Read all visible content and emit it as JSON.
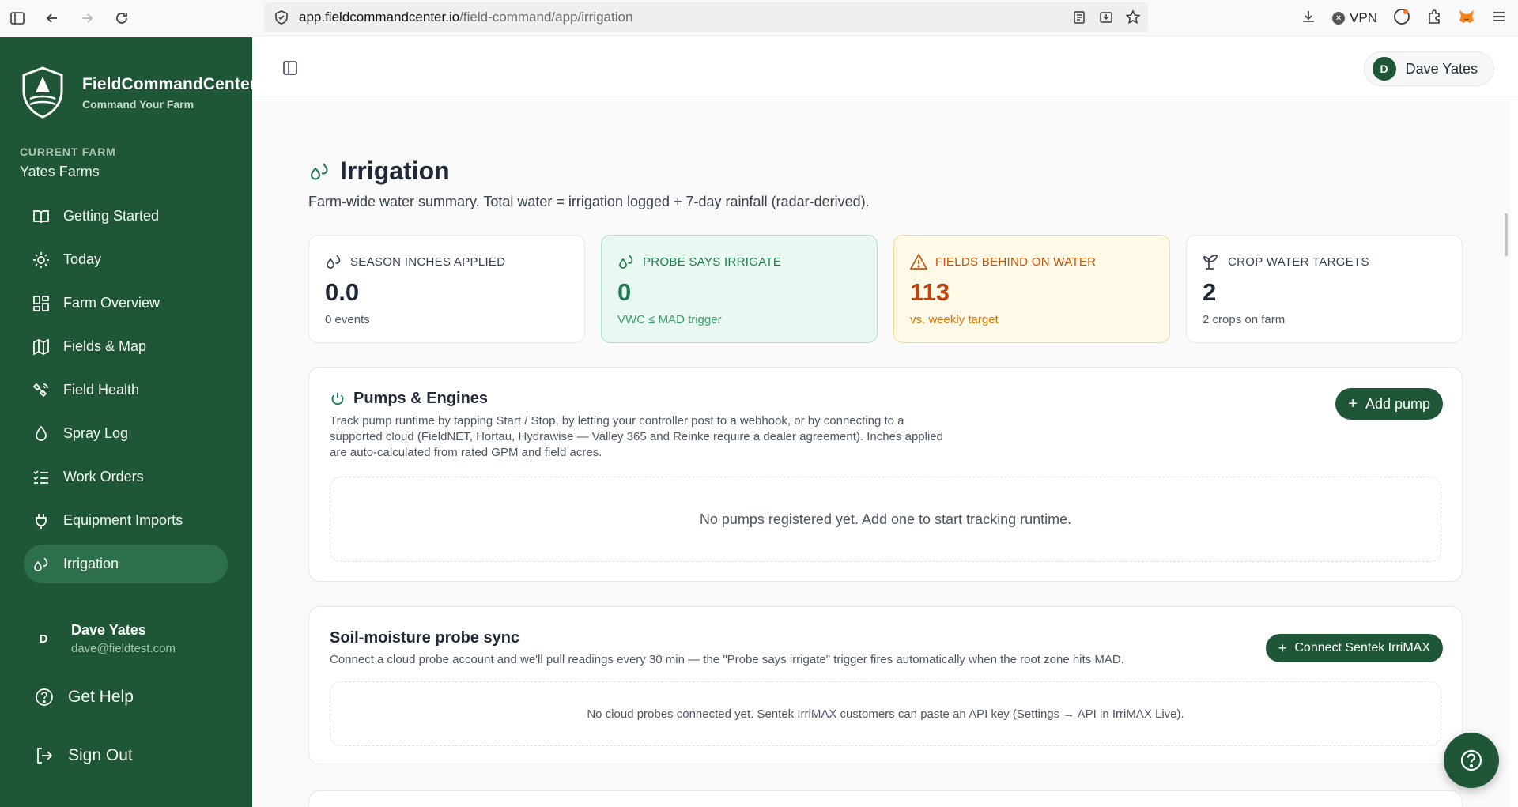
{
  "browser": {
    "url_host": "app.fieldcommandcenter.io",
    "url_path": "/field-command/app/irrigation",
    "vpn_label": "VPN"
  },
  "sidebar": {
    "brand_name": "FieldCommandCenter",
    "brand_tag": "Command Your Farm",
    "farm_label": "CURRENT FARM",
    "farm_name": "Yates Farms",
    "items": [
      {
        "label": "Getting Started",
        "icon": "book-icon"
      },
      {
        "label": "Today",
        "icon": "sun-icon"
      },
      {
        "label": "Farm Overview",
        "icon": "grid-icon"
      },
      {
        "label": "Fields & Map",
        "icon": "map-icon"
      },
      {
        "label": "Field Health",
        "icon": "satellite-icon"
      },
      {
        "label": "Spray Log",
        "icon": "droplet-icon"
      },
      {
        "label": "Work Orders",
        "icon": "list-checks-icon"
      },
      {
        "label": "Equipment Imports",
        "icon": "plug-icon"
      },
      {
        "label": "Irrigation",
        "icon": "droplets-icon"
      }
    ],
    "user_initial": "D",
    "user_name": "Dave Yates",
    "user_email": "dave@fieldtest.com",
    "help_label": "Get Help",
    "signout_label": "Sign Out"
  },
  "topbar": {
    "user_initial": "D",
    "user_name": "Dave Yates"
  },
  "page": {
    "title": "Irrigation",
    "subtitle": "Farm-wide water summary. Total water = irrigation logged + 7-day rainfall (radar-derived)."
  },
  "stats": [
    {
      "label": "SEASON INCHES APPLIED",
      "value": "0.0",
      "note": "0 events",
      "icon": "droplets-icon"
    },
    {
      "label": "PROBE SAYS IRRIGATE",
      "value": "0",
      "note": "VWC ≤ MAD trigger",
      "icon": "droplets-icon"
    },
    {
      "label": "FIELDS BEHIND ON WATER",
      "value": "113",
      "note": "vs. weekly target",
      "icon": "warning-icon"
    },
    {
      "label": "CROP WATER TARGETS",
      "value": "2",
      "note": "2 crops on farm",
      "icon": "sprout-icon"
    }
  ],
  "pumps": {
    "title": "Pumps & Engines",
    "desc_1": "Track pump runtime by tapping Start / Stop, by letting your controller post to a webhook, or by connecting to a",
    "desc_2": "supported cloud (FieldNET, Hortau, Hydrawise — Valley 365 and Reinke require a dealer agreement). Inches applied",
    "desc_3": "are auto-calculated from rated GPM and field acres.",
    "button_label": "Add pump",
    "empty_text": "No pumps registered yet. Add one to start tracking runtime."
  },
  "probe": {
    "title": "Soil-moisture probe sync",
    "desc": "Connect a cloud probe account and we'll pull readings every 30 min — the \"Probe says irrigate\" trigger fires automatically when the root zone hits MAD.",
    "button_label": "Connect Sentek IrriMAX",
    "empty_text": "No cloud probes connected yet. Sentek IrriMAX customers can paste an API key (Settings → API in IrriMAX Live)."
  },
  "colors": {
    "sidebar_bg": "#1f5638",
    "active_item": "#2d6e4b",
    "accent_green": "#1f7a52",
    "warning": "#c2410c"
  }
}
